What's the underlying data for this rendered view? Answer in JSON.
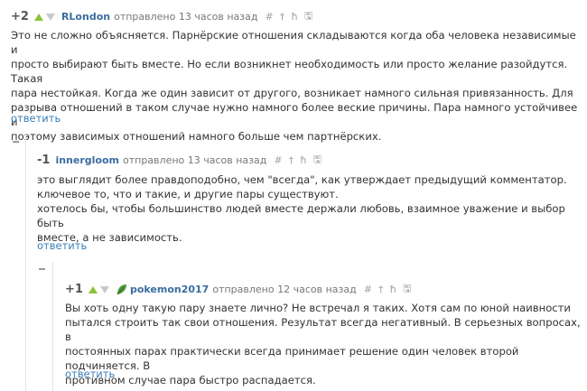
{
  "comments": [
    {
      "rating": "+2",
      "author": "RLondon",
      "sent": "отправлено 13 часов назад",
      "text": "Это не сложно объясняется. Парнёрские отношения складываются когда оба человека независимые и\nпросто выбирают быть вместе. Но если возникнет необходимость или просто желание разойдутся. Такая\nпара нестойкая. Когда же один зависит от другого, возникает намного сильная привязанность. Для\nразрыва отношений в таком случае нужно намного более веские причины. Пара намного устойчивее и\nпоэтому зависимых отношений намного больше чем партнёрских.",
      "reply": "ответить"
    },
    {
      "rating": "-1",
      "author": "innergloom",
      "sent": "отправлено 13 часов назад",
      "text": "это выглядит более правдоподобно, чем \"всегда\", как утверждает предыдущий комментатор.\nключевое то, что и такие, и другие пары существуют.\nхотелось бы, чтобы большинство людей вместе держали любовь, взаимное уважение и выбор быть\nвместе, а не зависимость.",
      "reply": "ответить"
    },
    {
      "rating": "+1",
      "author": "pokemon2017",
      "sent": "отправлено 12 часов назад",
      "text": "Вы хоть одну такую пару знаете лично?  Не встречал я таких. Хотя сам по юной наивности\nпытался строить так свои отношения. Результат всегда негативный.   В серьезных вопросах, в\nпостоянных парах практически всегда принимает решение один человек второй подчиняется. В\nпротивном случае пара быстро распадается.",
      "reply": "ответить"
    }
  ],
  "tool_icons": [
    "hash",
    "dagger",
    "h-bar",
    "save"
  ],
  "colors": {
    "author": "#3a6e9f",
    "up": "#8ac33b",
    "reply": "#3a7fb8"
  }
}
